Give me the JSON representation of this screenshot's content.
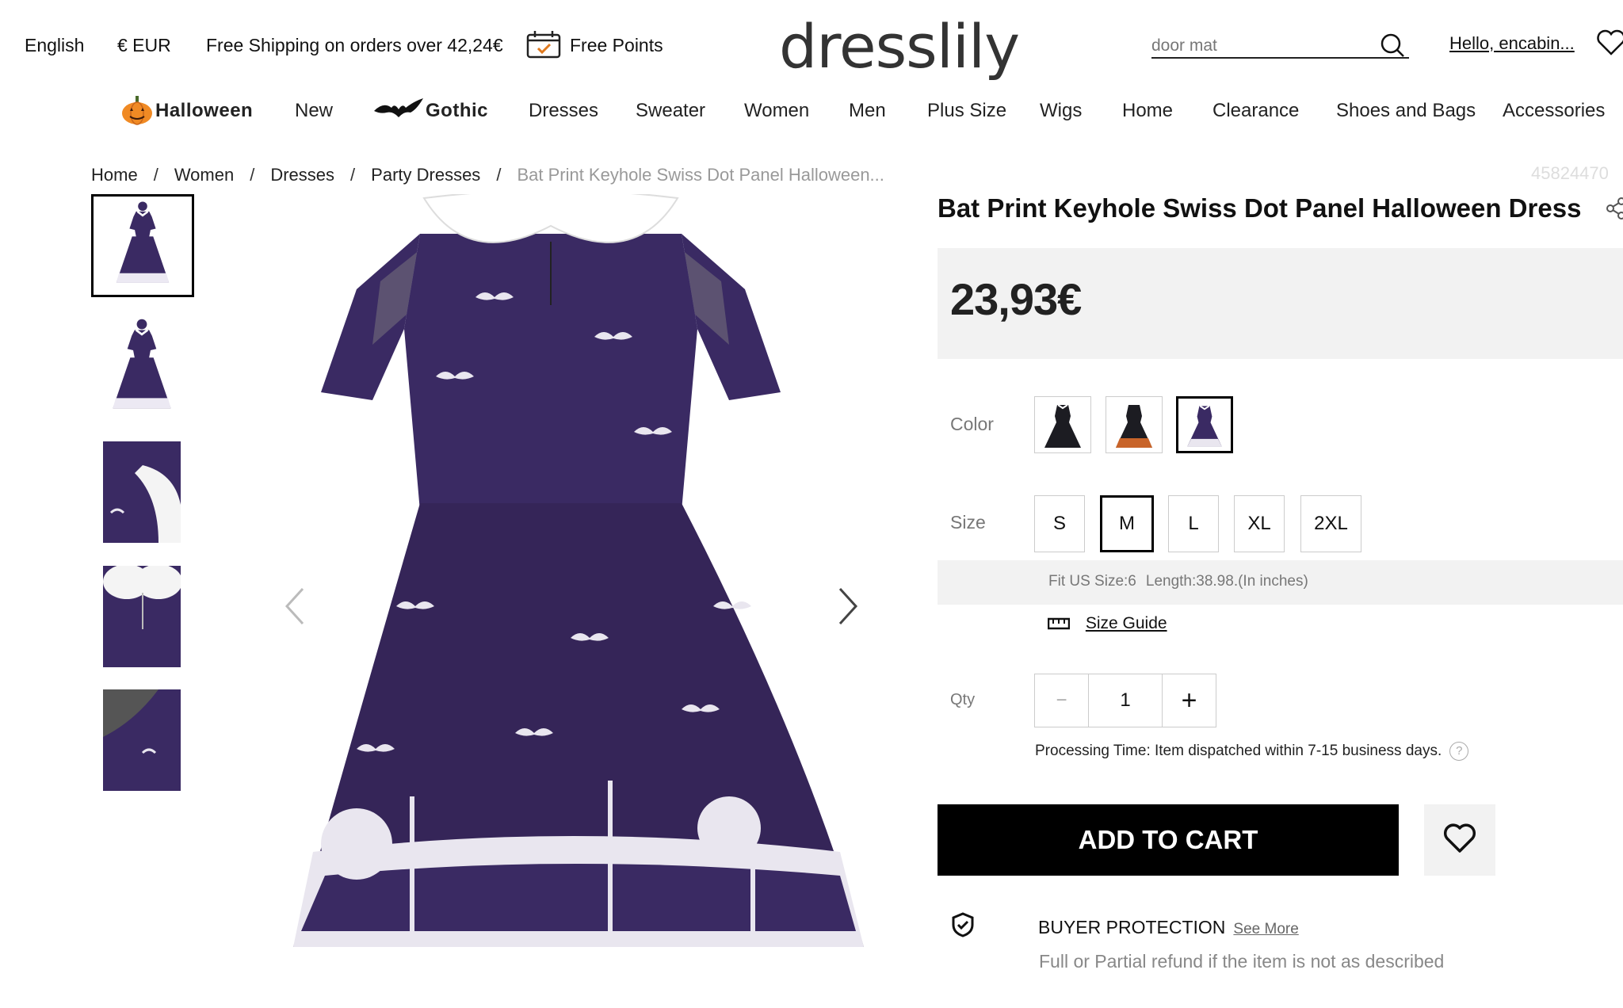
{
  "topbar": {
    "language": "English",
    "currency": "€ EUR",
    "shipping": "Free Shipping on orders over 42,24€",
    "points": "Free Points",
    "logo": "dresslily",
    "search_placeholder": "door mat",
    "account": "Hello, encabin..."
  },
  "nav": {
    "items": [
      "Halloween",
      "New",
      "Gothic",
      "Dresses",
      "Sweater",
      "Women",
      "Men",
      "Plus Size",
      "Wigs",
      "Home",
      "Clearance",
      "Shoes and Bags",
      "Accessories"
    ]
  },
  "breadcrumb": [
    "Home",
    "Women",
    "Dresses",
    "Party Dresses",
    "Bat Print Keyhole Swiss Dot Panel Halloween..."
  ],
  "breadcrumb_sep": "/",
  "sku": "45824470",
  "product": {
    "title": "Bat Print Keyhole Swiss Dot Panel Halloween Dress",
    "price": "23,93€",
    "color_label": "Color",
    "size_label": "Size",
    "sizes": [
      "S",
      "M",
      "L",
      "XL",
      "2XL"
    ],
    "selected_size": "M",
    "fit_size": "Fit US Size:6",
    "fit_length": "Length:38.98.(In inches)",
    "size_guide": "Size Guide",
    "qty_label": "Qty",
    "qty_minus": "−",
    "qty_value": "1",
    "qty_plus": "+",
    "processing": "Processing Time: Item dispatched within 7-15 business days.",
    "help": "?",
    "add_to_cart": "ADD TO CART",
    "buyer_protection": "BUYER PROTECTION",
    "see_more": "See More",
    "refund": "Full or Partial refund if the item is not as described"
  },
  "colors": {
    "dress_purple": "#3a2a63",
    "dress_black": "#1c1c22",
    "dress_orange": "#c8642a",
    "collar": "#ffffff",
    "bats": "#e9e6ef"
  }
}
